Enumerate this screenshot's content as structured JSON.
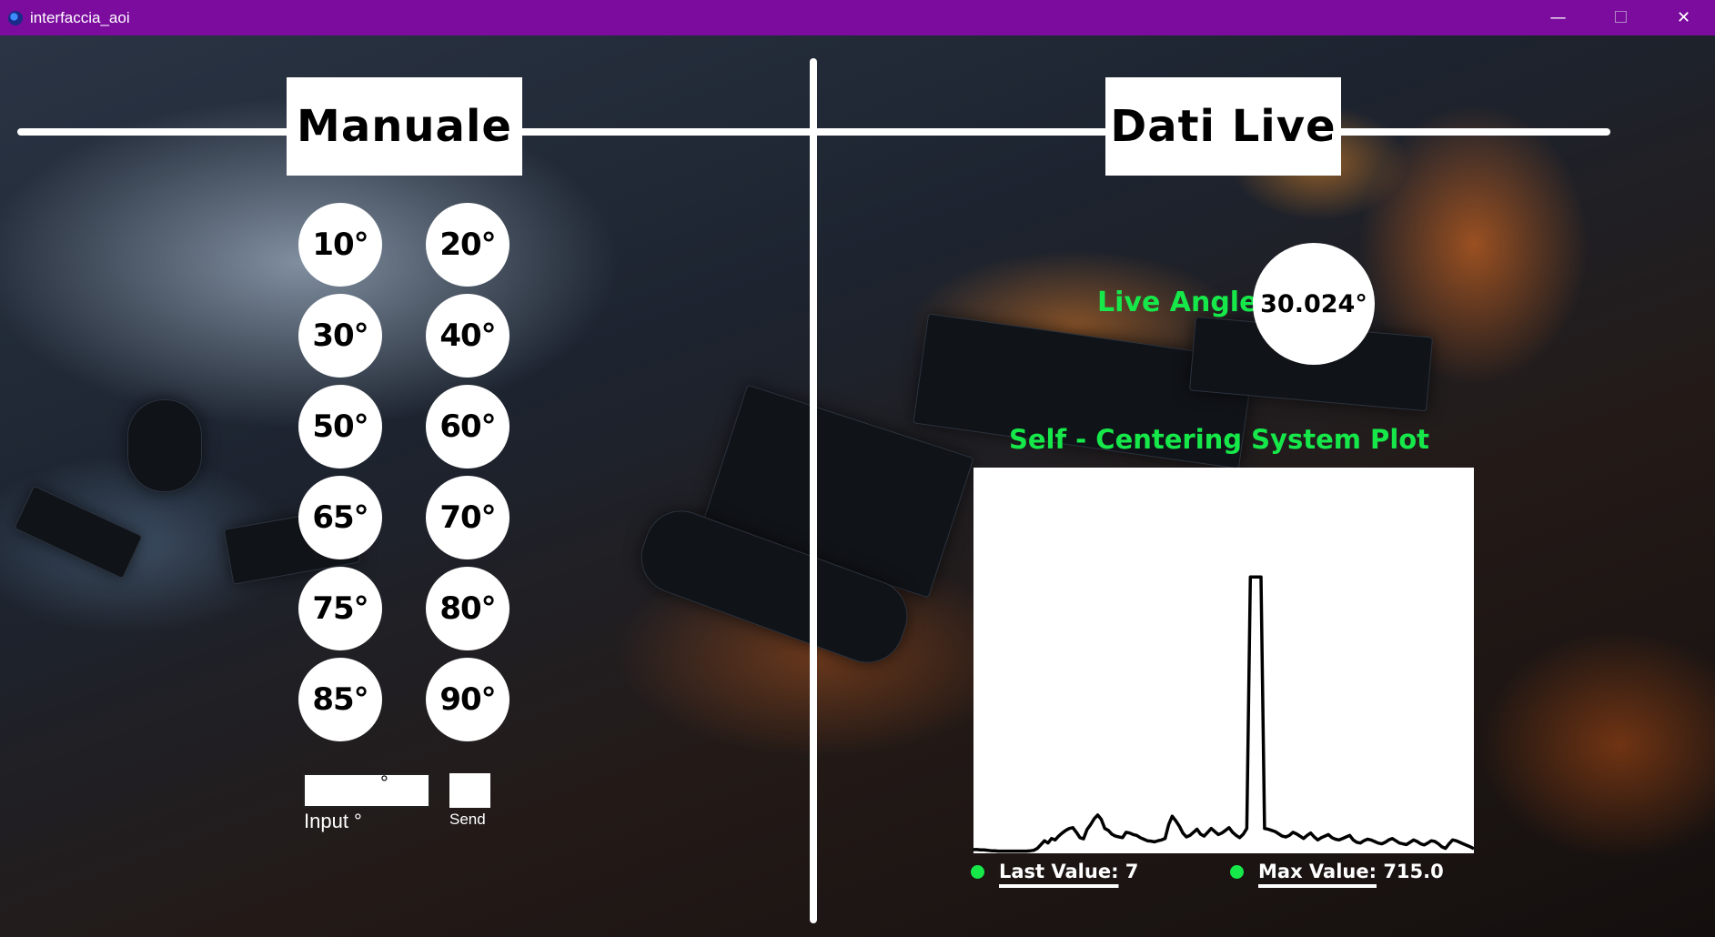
{
  "window": {
    "title": "interfaccia_aoi",
    "controls": {
      "minimize": "—",
      "maximize": "☐",
      "close": "✕"
    }
  },
  "manual": {
    "header": "Manuale",
    "angle_buttons": [
      "10°",
      "20°",
      "30°",
      "40°",
      "50°",
      "60°",
      "65°",
      "70°",
      "75°",
      "80°",
      "85°",
      "90°"
    ],
    "input": {
      "value": "",
      "suffix": "°",
      "label": "Input °"
    },
    "send_label": "Send"
  },
  "live": {
    "header": "Dati Live",
    "angle_label": "Live Angle:",
    "angle_value": "30.024°",
    "plot_title": "Self - Centering System Plot",
    "last_value_label": "Last Value:",
    "last_value": "7",
    "max_value_label": "Max Value:",
    "max_value": "715.0"
  },
  "colors": {
    "titlebar": "#7b0c9e",
    "accent_green": "#16e84a",
    "panel_white": "#ffffff"
  },
  "chart_data": {
    "type": "line",
    "title": "Self - Centering System Plot",
    "xlabel": "",
    "ylabel": "",
    "grid": false,
    "ylim": [
      0,
      1000
    ],
    "series": [
      {
        "values": [
          5,
          5,
          4,
          4,
          3,
          2,
          2,
          1,
          1,
          1,
          1,
          1,
          1,
          1,
          1,
          1,
          2,
          3,
          8,
          18,
          28,
          22,
          34,
          30,
          40,
          48,
          55,
          60,
          62,
          50,
          36,
          33,
          57,
          70,
          85,
          95,
          84,
          60,
          55,
          45,
          40,
          38,
          36,
          50,
          48,
          44,
          42,
          36,
          32,
          28,
          27,
          25,
          28,
          30,
          34,
          70,
          92,
          80,
          66,
          48,
          38,
          42,
          50,
          58,
          45,
          40,
          50,
          60,
          52,
          44,
          48,
          55,
          62,
          50,
          42,
          36,
          45,
          60,
          715,
          715,
          715,
          715,
          60,
          58,
          55,
          52,
          46,
          40,
          38,
          42,
          50,
          46,
          40,
          34,
          42,
          48,
          38,
          30,
          36,
          40,
          44,
          36,
          32,
          30,
          34,
          38,
          42,
          30,
          24,
          22,
          28,
          32,
          30,
          26,
          22,
          20,
          24,
          30,
          34,
          28,
          22,
          20,
          18,
          24,
          30,
          26,
          20,
          17,
          22,
          28,
          26,
          20,
          12,
          8,
          20,
          30,
          28,
          24,
          20,
          16,
          12,
          7
        ]
      }
    ]
  }
}
